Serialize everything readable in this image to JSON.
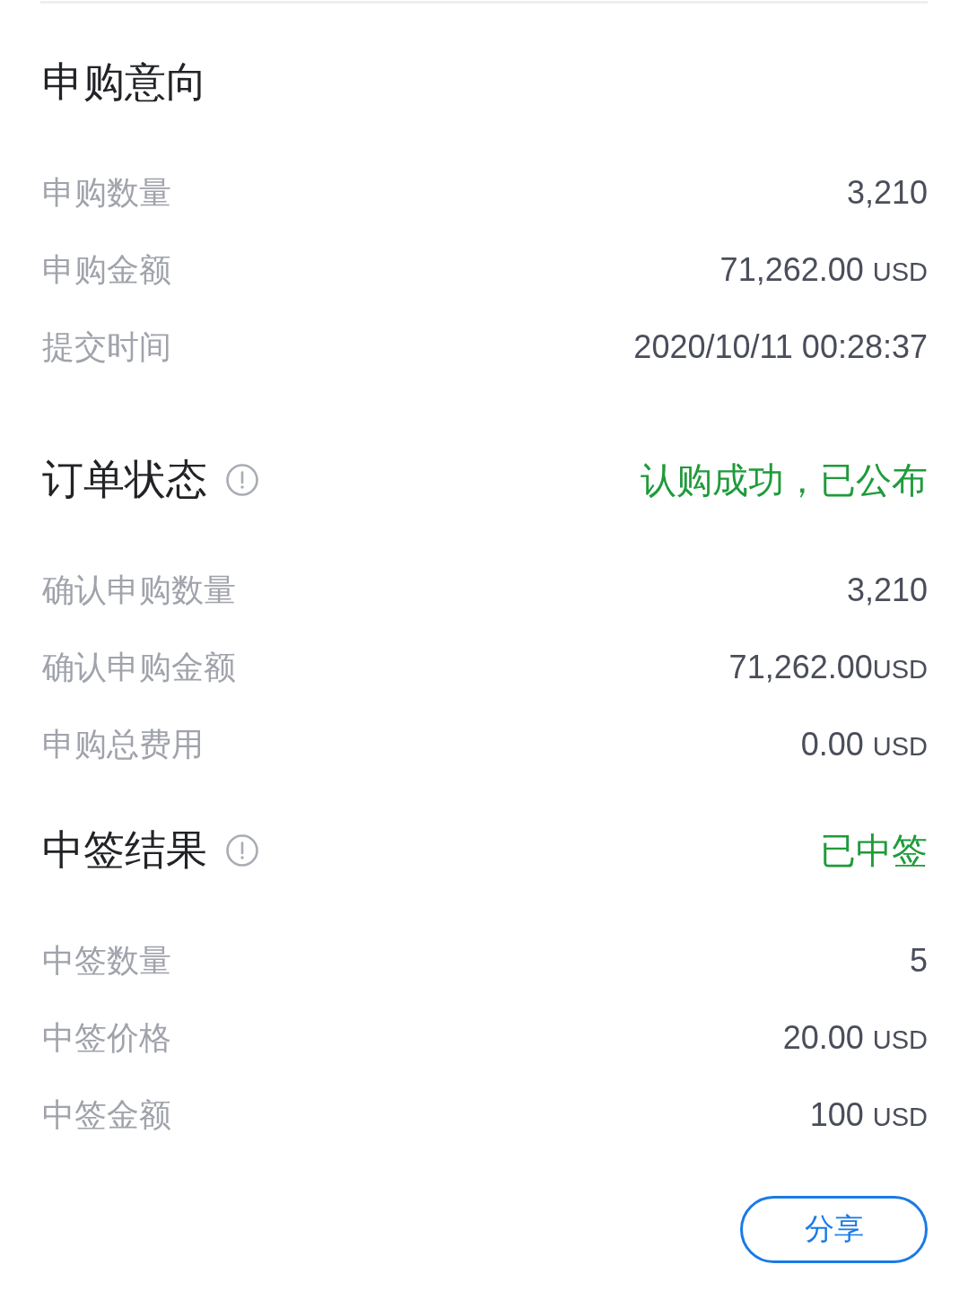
{
  "sections": [
    {
      "title": "申购意向",
      "info_icon": false,
      "rows": [
        {
          "label": "申购数量",
          "value": "3,210"
        },
        {
          "label": "申购金额",
          "value": "71,262.00",
          "unit": "USD",
          "unit_gap": true
        },
        {
          "label": "提交时间",
          "value": "2020/10/11 00:28:37"
        }
      ]
    },
    {
      "title": "订单状态",
      "info_icon": true,
      "status": "认购成功，已公布",
      "rows": [
        {
          "label": "确认申购数量",
          "value": "3,210"
        },
        {
          "label": "确认申购金额",
          "value": "71,262.00",
          "unit": "USD",
          "unit_gap": false
        },
        {
          "label": "申购总费用",
          "value": "0.00",
          "unit": "USD",
          "unit_gap": true
        }
      ]
    },
    {
      "title": "中签结果",
      "info_icon": true,
      "status": "已中签",
      "rows": [
        {
          "label": "中签数量",
          "value": "5"
        },
        {
          "label": "中签价格",
          "value": "20.00",
          "unit": "USD",
          "unit_gap": true
        },
        {
          "label": "中签金额",
          "value": "100",
          "unit": "USD",
          "unit_gap": true
        }
      ]
    }
  ],
  "share_button": {
    "label": "分享"
  }
}
